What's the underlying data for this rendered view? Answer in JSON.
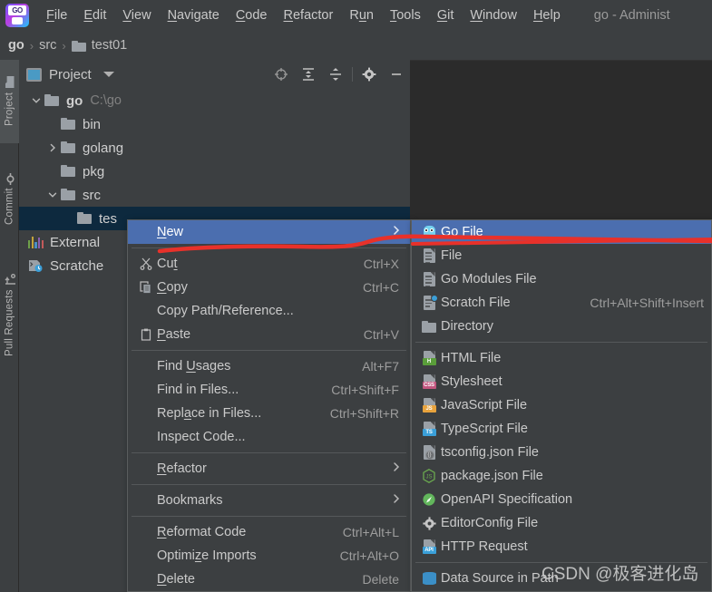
{
  "app": {
    "logo_text": "GO",
    "window_title": "go - Administ"
  },
  "menubar": {
    "items": [
      {
        "label": "File",
        "mnemonic": "F"
      },
      {
        "label": "Edit",
        "mnemonic": "E"
      },
      {
        "label": "View",
        "mnemonic": "V"
      },
      {
        "label": "Navigate",
        "mnemonic": "N"
      },
      {
        "label": "Code",
        "mnemonic": "C"
      },
      {
        "label": "Refactor",
        "mnemonic": "R"
      },
      {
        "label": "Run",
        "mnemonic": "u"
      },
      {
        "label": "Tools",
        "mnemonic": "T"
      },
      {
        "label": "Git",
        "mnemonic": "G"
      },
      {
        "label": "Window",
        "mnemonic": "W"
      },
      {
        "label": "Help",
        "mnemonic": "H"
      }
    ]
  },
  "breadcrumb": {
    "separator": "›",
    "items": [
      {
        "label": "go",
        "icon": "",
        "bold": true
      },
      {
        "label": "src",
        "icon": "",
        "bold": false
      },
      {
        "label": "test01",
        "icon": "folder-icon",
        "bold": false
      }
    ]
  },
  "toolstrip": {
    "items": [
      {
        "label": "Project",
        "icon": "folder-icon",
        "active": true
      },
      {
        "label": "Commit",
        "icon": "commit-icon",
        "active": false
      },
      {
        "label": "Pull Requests",
        "icon": "pull-request-icon",
        "active": false
      }
    ]
  },
  "project_panel": {
    "title": "Project",
    "title_icon": "project-icon",
    "dropdown_icon": "chevron-down-icon",
    "tools": [
      {
        "name": "locate-icon",
        "tooltip": "Select Opened File"
      },
      {
        "name": "expand-all-icon",
        "tooltip": "Expand All"
      },
      {
        "name": "collapse-all-icon",
        "tooltip": "Collapse All"
      },
      {
        "name": "settings-gear-icon",
        "tooltip": "Options"
      },
      {
        "name": "hide-icon",
        "tooltip": "Hide"
      }
    ],
    "tree": [
      {
        "label": "go",
        "path": "C:\\go",
        "icon": "folder-icon",
        "indent": 0,
        "arrow": "expanded",
        "bold": true,
        "selected": false
      },
      {
        "label": "bin",
        "path": "",
        "icon": "folder-icon",
        "indent": 1,
        "arrow": "none",
        "bold": false,
        "selected": false
      },
      {
        "label": "golang",
        "path": "",
        "icon": "folder-icon",
        "indent": 1,
        "arrow": "collapsed",
        "bold": false,
        "selected": false
      },
      {
        "label": "pkg",
        "path": "",
        "icon": "folder-icon",
        "indent": 1,
        "arrow": "none",
        "bold": false,
        "selected": false
      },
      {
        "label": "src",
        "path": "",
        "icon": "folder-icon",
        "indent": 1,
        "arrow": "expanded",
        "bold": false,
        "selected": false
      },
      {
        "label": "tes",
        "path": "",
        "icon": "folder-icon",
        "indent": 2,
        "arrow": "none",
        "bold": false,
        "selected": true
      },
      {
        "label": "External",
        "path": "",
        "icon": "library-icon",
        "indent": 0,
        "arrow": "none",
        "bold": false,
        "selected": false
      },
      {
        "label": "Scratche",
        "path": "",
        "icon": "scratch-icon",
        "indent": 0,
        "arrow": "none",
        "bold": false,
        "selected": false
      }
    ]
  },
  "context_menu": {
    "items": [
      {
        "label": "New",
        "mnemonic": "N",
        "shortcut": "",
        "icon": "",
        "submenu": true,
        "highlighted": true,
        "separator_after": true
      },
      {
        "label": "Cut",
        "mnemonic": "t",
        "shortcut": "Ctrl+X",
        "icon": "scissors-icon",
        "submenu": false,
        "highlighted": false,
        "separator_after": false
      },
      {
        "label": "Copy",
        "mnemonic": "C",
        "shortcut": "Ctrl+C",
        "icon": "copy-icon",
        "submenu": false,
        "highlighted": false,
        "separator_after": false
      },
      {
        "label": "Copy Path/Reference...",
        "mnemonic": "",
        "shortcut": "",
        "icon": "",
        "submenu": false,
        "highlighted": false,
        "separator_after": false
      },
      {
        "label": "Paste",
        "mnemonic": "P",
        "shortcut": "Ctrl+V",
        "icon": "clipboard-icon",
        "submenu": false,
        "highlighted": false,
        "separator_after": true
      },
      {
        "label": "Find Usages",
        "mnemonic": "U",
        "shortcut": "Alt+F7",
        "icon": "",
        "submenu": false,
        "highlighted": false,
        "separator_after": false
      },
      {
        "label": "Find in Files...",
        "mnemonic": "",
        "shortcut": "Ctrl+Shift+F",
        "icon": "",
        "submenu": false,
        "highlighted": false,
        "separator_after": false
      },
      {
        "label": "Replace in Files...",
        "mnemonic": "a",
        "shortcut": "Ctrl+Shift+R",
        "icon": "",
        "submenu": false,
        "highlighted": false,
        "separator_after": false
      },
      {
        "label": "Inspect Code...",
        "mnemonic": "",
        "shortcut": "",
        "icon": "",
        "submenu": false,
        "highlighted": false,
        "separator_after": true
      },
      {
        "label": "Refactor",
        "mnemonic": "R",
        "shortcut": "",
        "icon": "",
        "submenu": true,
        "highlighted": false,
        "separator_after": true
      },
      {
        "label": "Bookmarks",
        "mnemonic": "",
        "shortcut": "",
        "icon": "",
        "submenu": true,
        "highlighted": false,
        "separator_after": true
      },
      {
        "label": "Reformat Code",
        "mnemonic": "R",
        "shortcut": "Ctrl+Alt+L",
        "icon": "",
        "submenu": false,
        "highlighted": false,
        "separator_after": false
      },
      {
        "label": "Optimize Imports",
        "mnemonic": "z",
        "shortcut": "Ctrl+Alt+O",
        "icon": "",
        "submenu": false,
        "highlighted": false,
        "separator_after": false
      },
      {
        "label": "Delete",
        "mnemonic": "D",
        "shortcut": "Delete",
        "icon": "",
        "submenu": false,
        "highlighted": false,
        "separator_after": false
      }
    ]
  },
  "new_submenu": {
    "items": [
      {
        "label": "Go File",
        "shortcut": "",
        "icon": "gopher-icon",
        "highlighted": true,
        "separator_after": false
      },
      {
        "label": "File",
        "shortcut": "",
        "icon": "file-icon",
        "highlighted": false,
        "separator_after": false
      },
      {
        "label": "Go Modules File",
        "shortcut": "",
        "icon": "file-icon",
        "highlighted": false,
        "separator_after": false
      },
      {
        "label": "Scratch File",
        "shortcut": "Ctrl+Alt+Shift+Insert",
        "icon": "scratch-file-icon",
        "highlighted": false,
        "separator_after": false
      },
      {
        "label": "Directory",
        "shortcut": "",
        "icon": "directory-icon",
        "highlighted": false,
        "separator_after": true
      },
      {
        "label": "HTML File",
        "shortcut": "",
        "icon": "html-file-icon",
        "icon_tag": "H",
        "icon_color": "#5a9e3a",
        "highlighted": false,
        "separator_after": false
      },
      {
        "label": "Stylesheet",
        "shortcut": "",
        "icon": "css-file-icon",
        "icon_tag": "CSS",
        "icon_color": "#c2567f",
        "highlighted": false,
        "separator_after": false
      },
      {
        "label": "JavaScript File",
        "shortcut": "",
        "icon": "javascript-file-icon",
        "icon_tag": "JS",
        "icon_color": "#e8a33d",
        "highlighted": false,
        "separator_after": false
      },
      {
        "label": "TypeScript File",
        "shortcut": "",
        "icon": "typescript-file-icon",
        "icon_tag": "TS",
        "icon_color": "#3a9fd8",
        "highlighted": false,
        "separator_after": false
      },
      {
        "label": "tsconfig.json File",
        "shortcut": "",
        "icon": "tsconfig-file-icon",
        "highlighted": false,
        "separator_after": false
      },
      {
        "label": "package.json File",
        "shortcut": "",
        "icon": "node-package-icon",
        "highlighted": false,
        "separator_after": false
      },
      {
        "label": "OpenAPI Specification",
        "shortcut": "",
        "icon": "openapi-icon",
        "highlighted": false,
        "separator_after": false
      },
      {
        "label": "EditorConfig File",
        "shortcut": "",
        "icon": "gear-icon",
        "highlighted": false,
        "separator_after": false
      },
      {
        "label": "HTTP Request",
        "shortcut": "",
        "icon": "http-request-icon",
        "icon_tag": "API",
        "icon_color": "#3a9fd8",
        "highlighted": false,
        "separator_after": true
      },
      {
        "label": "Data Source in Path",
        "shortcut": "",
        "icon": "database-icon",
        "highlighted": false,
        "separator_after": false
      }
    ]
  },
  "annotation": {
    "color": "#e8312a",
    "description": "red hand-drawn underline from New to Go File"
  },
  "watermark": {
    "text": "CSDN @极客进化岛"
  },
  "colors": {
    "chrome_bg": "#3c3f41",
    "editor_bg": "#2b2b2b",
    "menu_highlight": "#4b6eaf",
    "tree_selection": "#0d293e",
    "text": "#cacaca",
    "muted_text": "#9d9d9d"
  }
}
